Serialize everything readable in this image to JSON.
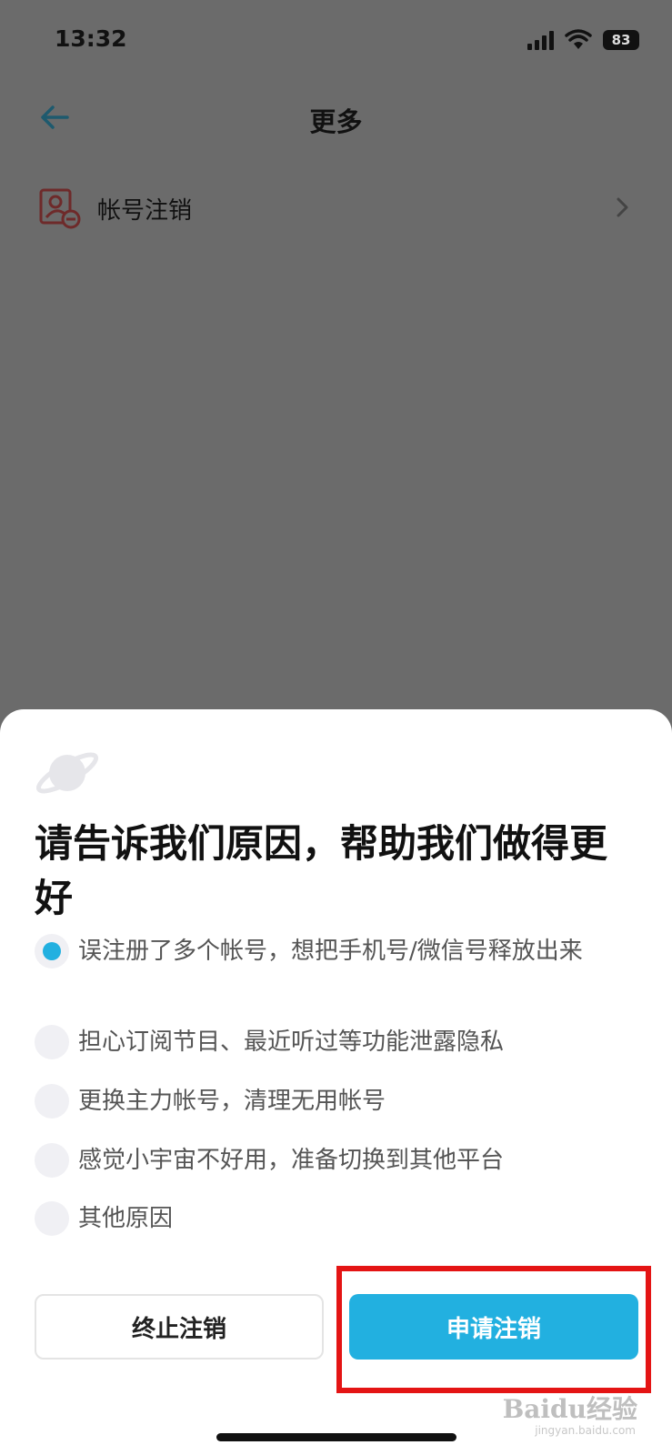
{
  "status_bar": {
    "time": "13:32",
    "battery": "83"
  },
  "nav": {
    "title": "更多"
  },
  "menu": {
    "label": "帐号注销"
  },
  "sheet": {
    "title": "请告诉我们原因，帮助我们做得更好",
    "reasons": [
      {
        "text": "误注册了多个帐号，想把手机号/微信号释放出来",
        "checked": true
      },
      {
        "text": "担心订阅节目、最近听过等功能泄露隐私",
        "checked": false
      },
      {
        "text": "更换主力帐号，清理无用帐号",
        "checked": false
      },
      {
        "text": "感觉小宇宙不好用，准备切换到其他平台",
        "checked": false
      },
      {
        "text": "其他原因",
        "checked": false
      }
    ],
    "cancel_label": "终止注销",
    "confirm_label": "申请注销"
  },
  "watermark": {
    "brand": "Baidu经验",
    "url": "jingyan.baidu.com"
  },
  "colors": {
    "accent": "#22b0e0",
    "highlight": "#e41414",
    "overlay": "#6b6b6b"
  }
}
